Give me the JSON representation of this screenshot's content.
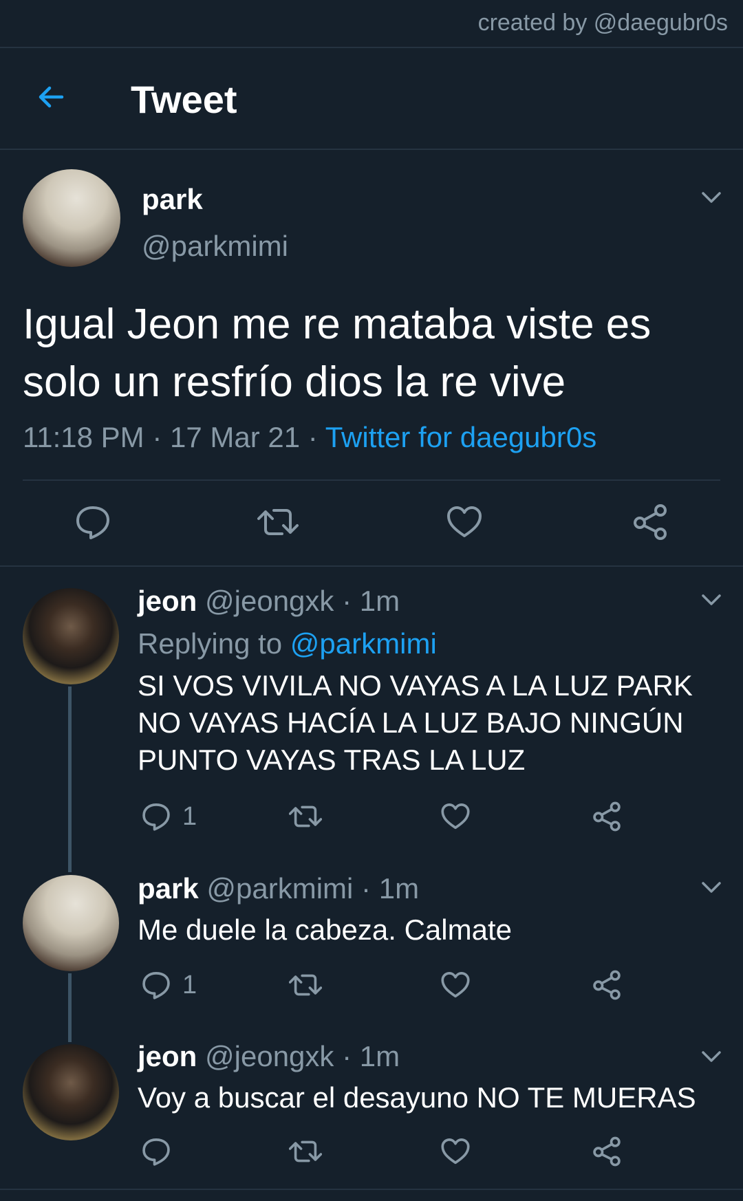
{
  "credit": "created by @daegubr0s",
  "header": {
    "title": "Tweet"
  },
  "main_tweet": {
    "name": "park",
    "handle": "@parkmimi",
    "text": "Igual Jeon me re mataba viste es solo un resfrío dios la re vive",
    "time": "11:18 PM",
    "date": "17 Mar 21",
    "source": "Twitter for daegubr0s",
    "dot": "·"
  },
  "replies": [
    {
      "name": "jeon",
      "handle": "@jeongxk",
      "age": "1m",
      "replying_prefix": "Replying to",
      "replying_to": "@parkmimi",
      "text": "SI VOS VIVILA NO VAYAS A LA LUZ PARK NO VAYAS HACÍA LA LUZ BAJO NINGÚN PUNTO VAYAS TRAS LA LUZ",
      "reply_count": "1"
    },
    {
      "name": "park",
      "handle": "@parkmimi",
      "age": "1m",
      "text": "Me duele la cabeza. Calmate",
      "reply_count": "1"
    },
    {
      "name": "jeon",
      "handle": "@jeongxk",
      "age": "1m",
      "text": "Voy a buscar el desayuno NO TE MUERAS",
      "reply_count": ""
    }
  ],
  "icons": {
    "back": "back-arrow-icon",
    "reply": "reply-icon",
    "retweet": "retweet-icon",
    "like": "like-icon",
    "share": "share-icon",
    "more": "chevron-down-icon"
  },
  "colors": {
    "background": "#15202b",
    "accent": "#1da1f2",
    "muted": "#8899a6",
    "divider": "#253341"
  }
}
